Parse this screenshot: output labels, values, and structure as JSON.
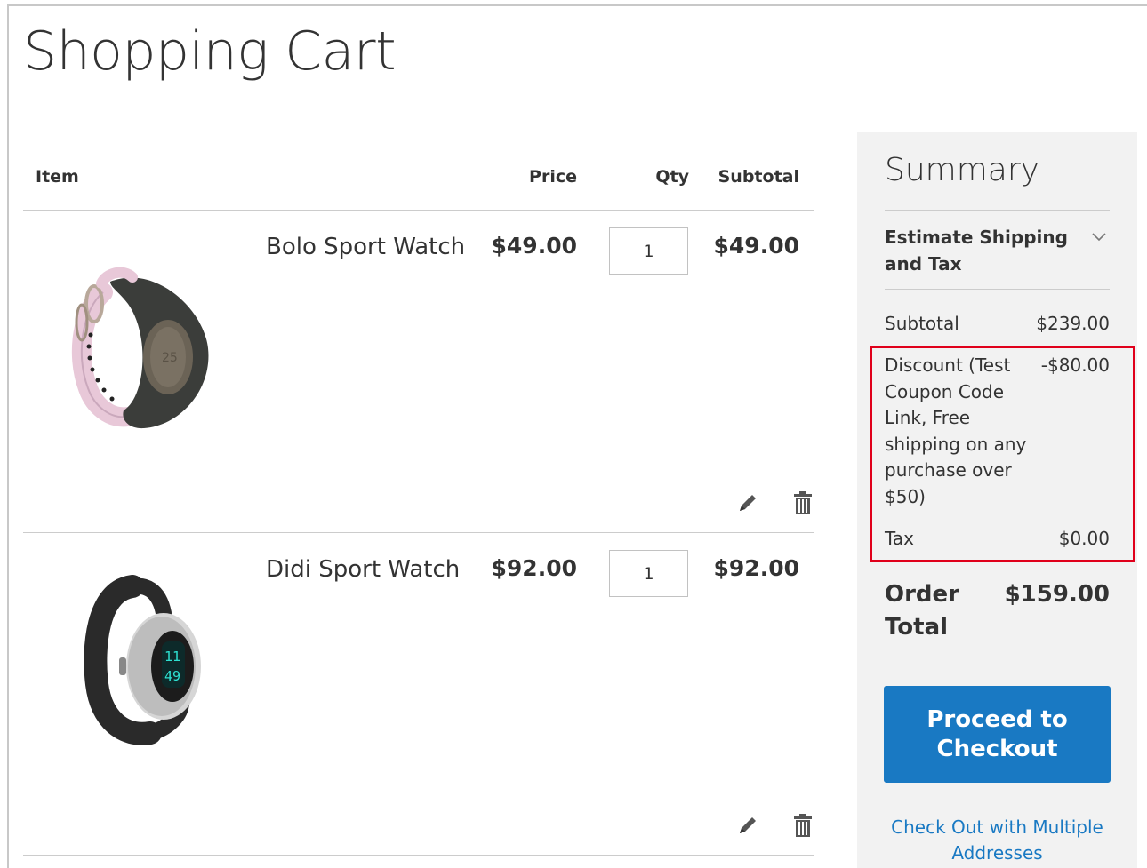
{
  "page": {
    "title": "Shopping Cart"
  },
  "cart": {
    "columns": {
      "item": "Item",
      "price": "Price",
      "qty": "Qty",
      "subtotal": "Subtotal"
    },
    "items": [
      {
        "name": "Bolo Sport Watch",
        "price": "$49.00",
        "qty": "1",
        "subtotal": "$49.00",
        "image_icon": "watch-pink-icon"
      },
      {
        "name": "Didi Sport Watch",
        "price": "$92.00",
        "qty": "1",
        "subtotal": "$92.00",
        "image_icon": "watch-silver-icon"
      }
    ],
    "actions": {
      "edit_icon": "pencil-icon",
      "delete_icon": "trash-icon"
    }
  },
  "summary": {
    "title": "Summary",
    "estimate_shipping": "Estimate Shipping and Tax",
    "subtotal_label": "Subtotal",
    "subtotal_value": "$239.00",
    "discount_label": "Discount (Test Coupon Code Link, Free shipping on any purchase over $50)",
    "discount_value": "-$80.00",
    "tax_label": "Tax",
    "tax_value": "$0.00",
    "order_total_label": "Order Total",
    "order_total_value": "$159.00",
    "checkout_label": "Proceed to Checkout",
    "multi_address_label": "Check Out with Multiple Addresses"
  },
  "colors": {
    "accent": "#1979c3",
    "highlight": "#e0001b",
    "summary_bg": "#f2f2f2",
    "text": "#333333"
  }
}
